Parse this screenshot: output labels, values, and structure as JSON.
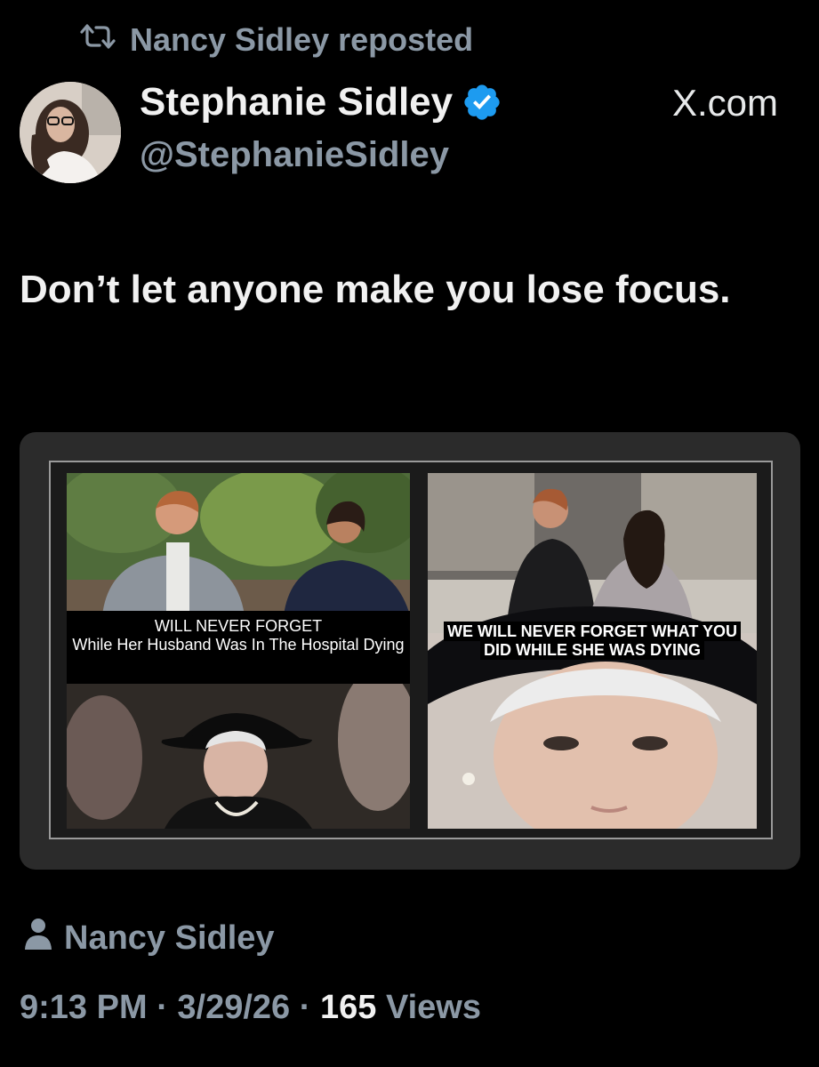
{
  "repost": {
    "label": "Nancy Sidley reposted",
    "icon": "repost-icon"
  },
  "author": {
    "display_name": "Stephanie Sidley",
    "handle": "@StephanieSidley",
    "verified": true,
    "verified_color": "#1d9bf0"
  },
  "source_watermark": "X.com",
  "post": {
    "text": "Don’t let anyone make you lose focus."
  },
  "media": {
    "left_panel": {
      "caption_line1": "WILL NEVER FORGET",
      "caption_line2": "While Her Husband Was In The Hospital Dying"
    },
    "right_panel": {
      "caption": "WE WILL NEVER FORGET WHAT YOU DID WHILE SHE WAS DYING"
    }
  },
  "attribution": {
    "icon": "person-icon",
    "name": "Nancy Sidley"
  },
  "meta": {
    "time": "9:13 PM",
    "separator": "·",
    "date": "3/29/26",
    "views_count": "165",
    "views_label": "Views"
  },
  "colors": {
    "background": "#000000",
    "secondary_text": "#8b98a5",
    "card": "#2b2b2b"
  }
}
